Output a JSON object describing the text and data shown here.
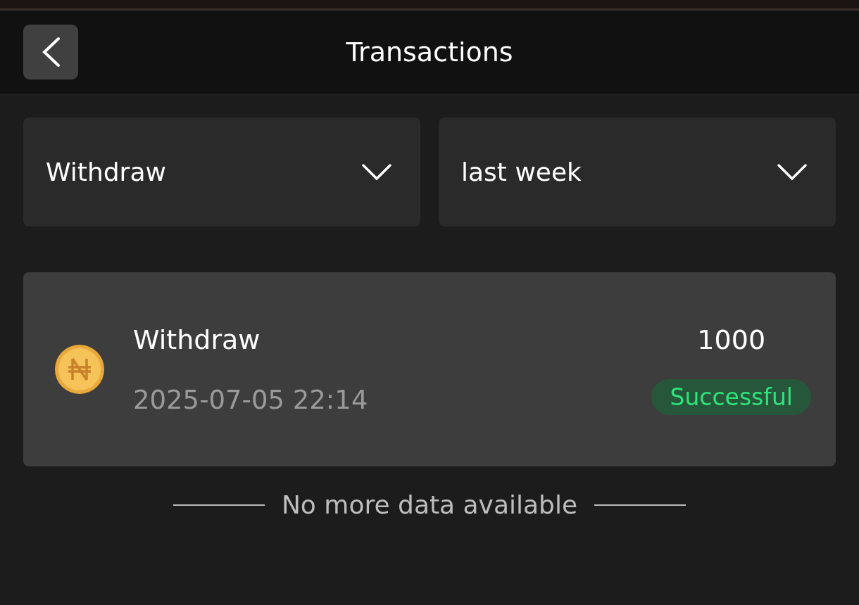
{
  "header": {
    "title": "Transactions"
  },
  "filters": [
    {
      "value": "Withdraw"
    },
    {
      "value": "last week"
    }
  ],
  "transactions": [
    {
      "type": "Withdraw",
      "date": "2025-07-05 22:14",
      "amount": "1000",
      "status": {
        "label": "Successful",
        "kind": "success"
      }
    }
  ],
  "footer": {
    "text": "No more data available"
  }
}
